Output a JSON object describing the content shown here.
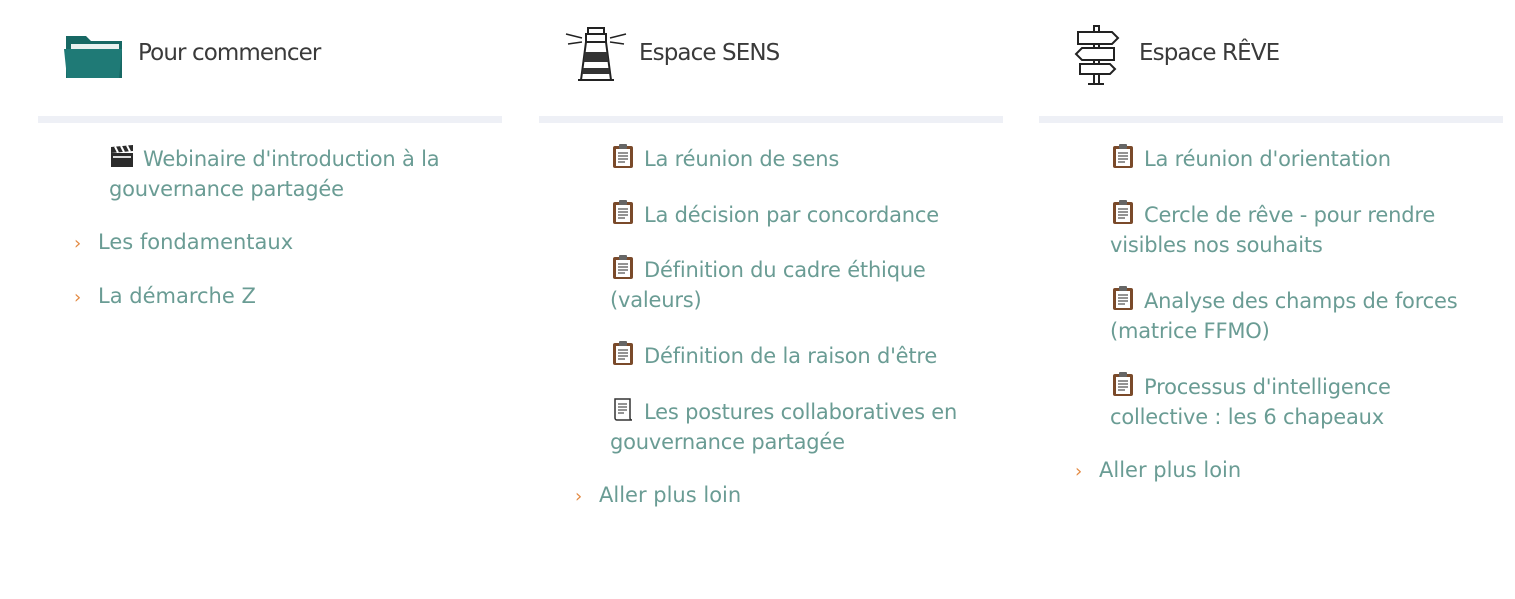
{
  "columns": [
    {
      "title": "Pour commencer",
      "icon": "folder-icon",
      "entries": [
        {
          "icon": "clapperboard-icon",
          "label": "Webinaire d'introduction à la gouvernance partagée"
        }
      ],
      "links": [
        {
          "label": "Les fondamentaux"
        },
        {
          "label": "La démarche Z"
        }
      ]
    },
    {
      "title": "Espace SENS",
      "icon": "lighthouse-icon",
      "entries": [
        {
          "icon": "clipboard-icon",
          "label": "La réunion de sens"
        },
        {
          "icon": "clipboard-icon",
          "label": "La décision par concordance"
        },
        {
          "icon": "clipboard-icon",
          "label": "Définition du cadre éthique (valeurs)"
        },
        {
          "icon": "clipboard-icon",
          "label": "Définition de la raison d'être"
        },
        {
          "icon": "scroll-icon",
          "label": "Les postures collaboratives en gouvernance partagée"
        }
      ],
      "links": [
        {
          "label": "Aller plus loin"
        }
      ]
    },
    {
      "title": "Espace RÊVE",
      "icon": "signpost-icon",
      "entries": [
        {
          "icon": "clipboard-icon",
          "label": "La réunion d'orientation"
        },
        {
          "icon": "clipboard-icon",
          "label": "Cercle de rêve - pour rendre visibles nos souhaits"
        },
        {
          "icon": "clipboard-icon",
          "label": "Analyse des champs de forces (matrice FFMO)"
        },
        {
          "icon": "clipboard-icon",
          "label": "Processus d'intelligence collective : les 6 chapeaux"
        }
      ],
      "links": [
        {
          "label": "Aller plus loin"
        }
      ]
    }
  ],
  "colors": {
    "link_text": "#6a9c94",
    "chevron": "#e38a43",
    "title_text": "#3a3a3a",
    "divider": "#eef0f6",
    "folder": "#1f7a76"
  }
}
